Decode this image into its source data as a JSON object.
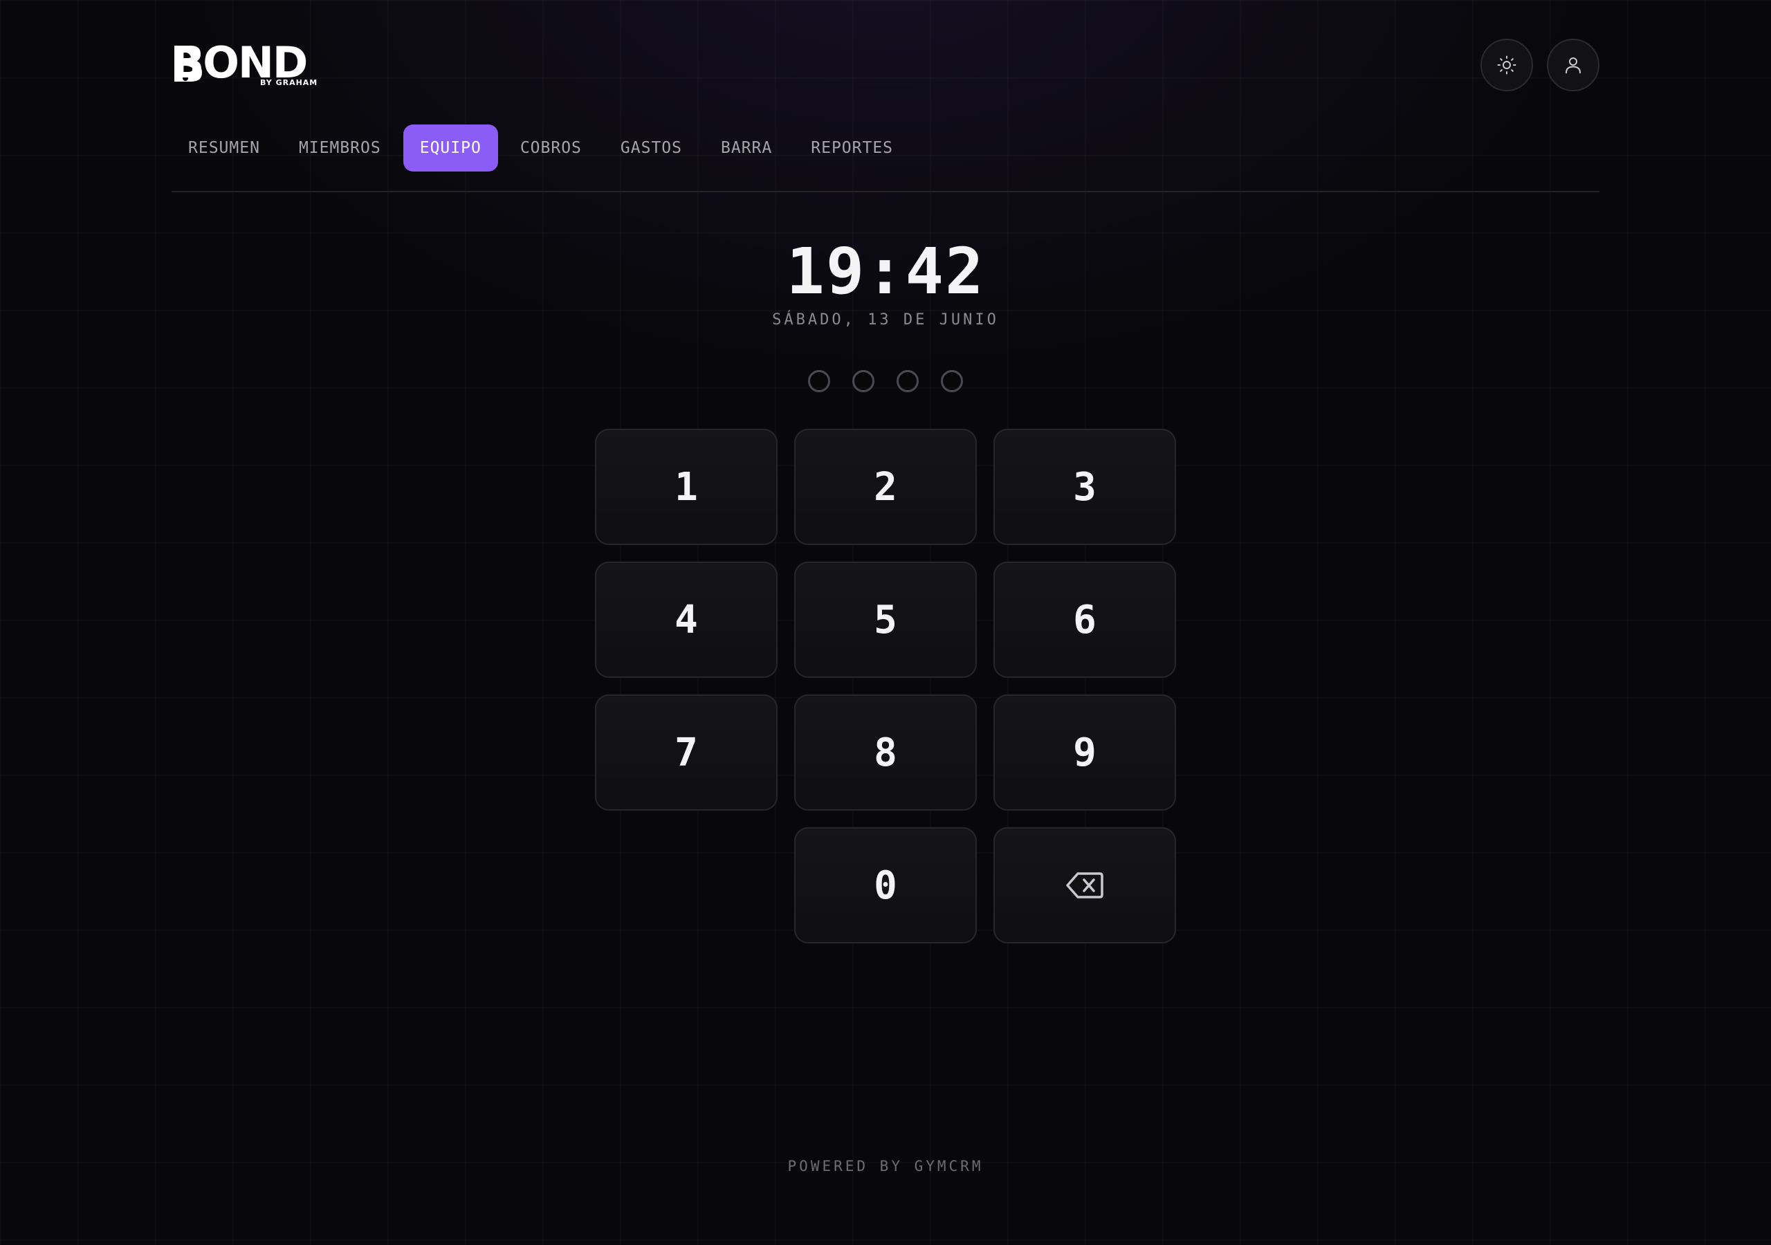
{
  "brand": {
    "name": "BOND",
    "tagline": "BY GRAHAM"
  },
  "header": {
    "theme_toggle_icon": "sun-icon",
    "profile_icon": "user-icon"
  },
  "nav": {
    "tabs": [
      {
        "label": "RESUMEN",
        "active": false
      },
      {
        "label": "MIEMBROS",
        "active": false
      },
      {
        "label": "EQUIPO",
        "active": true
      },
      {
        "label": "COBROS",
        "active": false
      },
      {
        "label": "GASTOS",
        "active": false
      },
      {
        "label": "BARRA",
        "active": false
      },
      {
        "label": "REPORTES",
        "active": false
      }
    ]
  },
  "clock": {
    "time": "19:42",
    "date": "SÁBADO, 13 DE JUNIO"
  },
  "pin": {
    "length": 4,
    "filled": 0
  },
  "keypad": {
    "keys": [
      "1",
      "2",
      "3",
      "4",
      "5",
      "6",
      "7",
      "8",
      "9",
      "0"
    ],
    "backspace_icon": "backspace-icon"
  },
  "footer": {
    "text": "POWERED BY GYMCRM"
  },
  "colors": {
    "accent": "#8b5cf6",
    "background": "#08080a",
    "key_surface": "#131316"
  }
}
